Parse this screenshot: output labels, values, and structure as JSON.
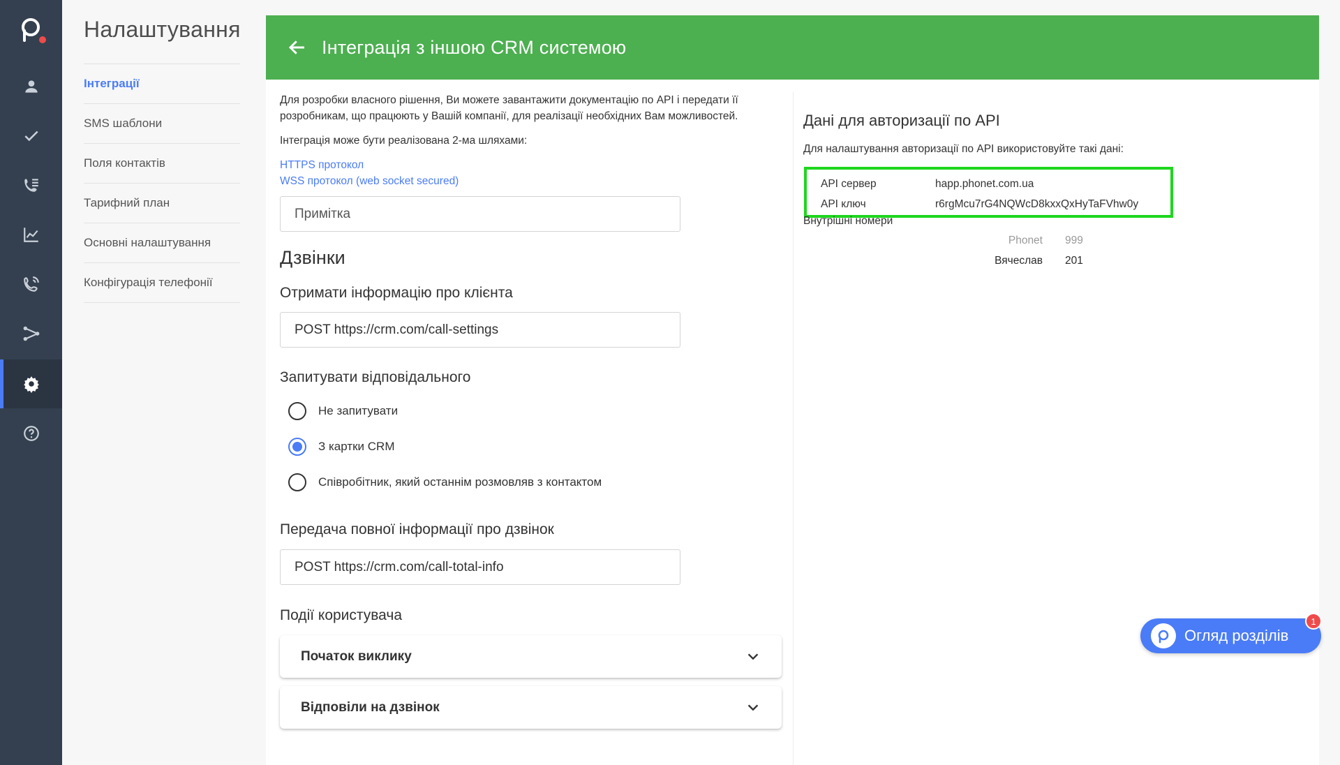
{
  "sidebar": {
    "items": [
      {
        "icon": "user-icon"
      },
      {
        "icon": "check-icon"
      },
      {
        "icon": "call-list-icon"
      },
      {
        "icon": "chart-icon"
      },
      {
        "icon": "phone-icon"
      },
      {
        "icon": "integration-icon"
      },
      {
        "icon": "gear-icon",
        "active": true
      },
      {
        "icon": "help-icon"
      }
    ],
    "accent": "#4a7cf7",
    "logo_dot_color": "#ef4b4b"
  },
  "settings": {
    "title": "Налаштування",
    "menu": [
      {
        "label": "Інтеграції",
        "active": true
      },
      {
        "label": "SMS шаблони"
      },
      {
        "label": "Поля контактів"
      },
      {
        "label": "Тарифний план"
      },
      {
        "label": "Основні налаштування"
      },
      {
        "label": "Конфігурація телефонії"
      }
    ]
  },
  "header": {
    "title": "Інтеграція з іншою CRM системою",
    "color": "#4caf50"
  },
  "intro": {
    "line1": "Для розробки власного рішення, Ви можете завантажити документацію по API і передати її",
    "line2": "розробникам, що працюють у Вашій компанії, для реалізації необхідних Вам можливостей.",
    "ways": "Інтеграція може бути реалізована 2-ма шляхами:",
    "link_https": "HTTPS протокол",
    "link_wss": "WSS протокол (web socket secured)"
  },
  "note_input": {
    "placeholder": "Примітка"
  },
  "calls": {
    "title": "Дзвінки",
    "client_info_title": "Отримати інформацію про клієнта",
    "client_info_value": "POST https://crm.com/call-settings",
    "responsible_title": "Запитувати відповідального",
    "responsible_options": [
      {
        "label": "Не запитувати",
        "checked": false
      },
      {
        "label": "З картки CRM",
        "checked": true
      },
      {
        "label": "Співробітник, який останнім розмовляв з контактом",
        "checked": false
      }
    ],
    "total_info_title": "Передача повної інформації про дзвінок",
    "total_info_value": "POST https://crm.com/call-total-info"
  },
  "user_events": {
    "title": "Події користувача",
    "items": [
      {
        "label": "Початок виклику"
      },
      {
        "label": "Відповіли на дзвінок"
      }
    ]
  },
  "api": {
    "title": "Дані для авторизації по API",
    "note": "Для налаштування авторизації по API використовуйте такі дані:",
    "rows": [
      {
        "key": "API сервер",
        "value": "happ.phonet.com.ua"
      },
      {
        "key": "API ключ",
        "value": "r6rgMcu7rG4NQWcD8kxxQxHyTaFVhw0y"
      }
    ],
    "highlight_color": "#1ed61e",
    "extensions_title": "Внутрішні номери",
    "extensions": [
      {
        "name": "Phonet",
        "number": "999",
        "muted": true
      },
      {
        "name": "Вячеслав",
        "number": "201",
        "muted": false
      }
    ]
  },
  "tour": {
    "label": "Огляд розділів",
    "badge": "1"
  }
}
